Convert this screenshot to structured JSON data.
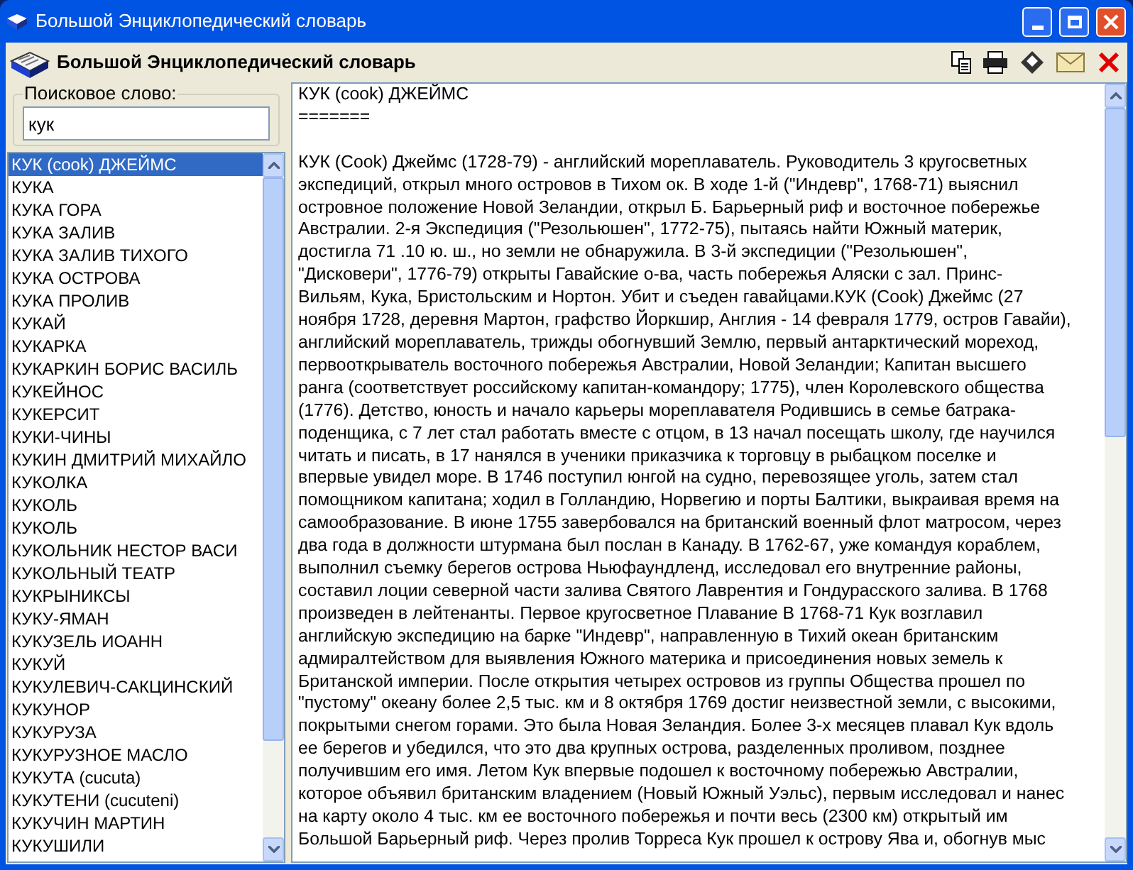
{
  "window": {
    "title": "Большой Энциклопедический словарь"
  },
  "header": {
    "title": "Большой Энциклопедический словарь"
  },
  "search": {
    "label": "Поисковое слово:",
    "value": "кук"
  },
  "entries": [
    {
      "label": "КУК (cook) ДЖЕЙМС",
      "selected": true
    },
    {
      "label": "КУКА",
      "selected": false
    },
    {
      "label": "КУКА ГОРА",
      "selected": false
    },
    {
      "label": "КУКА ЗАЛИВ",
      "selected": false
    },
    {
      "label": "КУКА ЗАЛИВ ТИХОГО",
      "selected": false
    },
    {
      "label": "КУКА ОСТРОВА",
      "selected": false
    },
    {
      "label": "КУКА ПРОЛИВ",
      "selected": false
    },
    {
      "label": "КУКАЙ",
      "selected": false
    },
    {
      "label": "КУКАРКА",
      "selected": false
    },
    {
      "label": "КУКАРКИН БОРИС ВАСИЛЬ",
      "selected": false
    },
    {
      "label": "КУКЕЙНОС",
      "selected": false
    },
    {
      "label": "КУКЕРСИТ",
      "selected": false
    },
    {
      "label": "КУКИ-ЧИНЫ",
      "selected": false
    },
    {
      "label": "КУКИН ДМИТРИЙ МИХАЙЛО",
      "selected": false
    },
    {
      "label": "КУКОЛКА",
      "selected": false
    },
    {
      "label": "КУКОЛЬ",
      "selected": false
    },
    {
      "label": "КУКОЛЬ",
      "selected": false
    },
    {
      "label": "КУКОЛЬНИК НЕСТОР ВАСИ",
      "selected": false
    },
    {
      "label": "КУКОЛЬНЫЙ ТЕАТР",
      "selected": false
    },
    {
      "label": "КУКРЫНИКСЫ",
      "selected": false
    },
    {
      "label": "КУКУ-ЯМАН",
      "selected": false
    },
    {
      "label": "КУКУЗЕЛЬ ИОАНН",
      "selected": false
    },
    {
      "label": "КУКУЙ",
      "selected": false
    },
    {
      "label": "КУКУЛЕВИЧ-САКЦИНСКИЙ",
      "selected": false
    },
    {
      "label": "КУКУНОР",
      "selected": false
    },
    {
      "label": "КУКУРУЗА",
      "selected": false
    },
    {
      "label": "КУКУРУЗНОЕ МАСЛО",
      "selected": false
    },
    {
      "label": "КУКУТА (cucuta)",
      "selected": false
    },
    {
      "label": "КУКУТЕНИ (cucuteni)",
      "selected": false
    },
    {
      "label": "КУКУЧИН МАРТИН",
      "selected": false
    },
    {
      "label": "КУКУШИЛИ",
      "selected": false
    }
  ],
  "article": {
    "heading": "КУК (cook) ДЖЕЙМС",
    "rule": "=======",
    "lines": [
      "КУК (Cook) Джеймс (1728-79) - английский мореплаватель. Руководитель 3 кругосветных",
      "экспедиций, открыл много островов в Тихом ок. В ходе 1-й (\"Индевр\", 1768-71) выяснил",
      "островное положение Новой Зеландии, открыл Б. Барьерный риф и восточное побережье",
      "Австралии. 2-я Экспедиция (\"Резольюшен\", 1772-75), пытаясь найти Южный материк,",
      "достигла 71 .10 ю. ш., но земли не обнаружила. В 3-й экспедиции (\"Резольюшен\",",
      "\"Дисковери\", 1776-79) открыты Гавайские о-ва, часть побережья Аляски с зал. Принс-",
      "Вильям, Кука, Бристольским и Нортон. Убит и съеден гавайцами.КУК (Cook) Джеймс (27",
      "ноября 1728, деревня Мартон, графство Йоркшир, Англия - 14 февраля 1779, остров Гавайи),",
      "английский мореплаватель, трижды обогнувший Землю, первый антарктический мореход,",
      "первооткрыватель восточного побережья Австралии, Новой Зеландии; Капитан высшего",
      "ранга (соответствует российскому капитан-командору; 1775), член Королевского общества",
      "(1776). Детство, юность и начало карьеры мореплавателя Родившись в семье батрака-",
      "поденщика, с 7 лет стал работать вместе с отцом, в 13 начал посещать школу, где научился",
      "читать и писать, в 17 нанялся в ученики приказчика к торговцу в рыбацком поселке и",
      "впервые увидел море. В 1746 поступил юнгой на судно, перевозящее уголь, затем стал",
      "помощником капитана; ходил в Голландию, Норвегию и порты Балтики, выкраивая время на",
      "самообразование. В июне 1755 завербовался на британский военный флот матросом, через",
      "два года в должности штурмана был послан в Канаду. В 1762-67, уже командуя кораблем,",
      "выполнил съемку берегов острова Ньюфаундленд, исследовал его внутренние районы,",
      "составил лоции северной части залива Святого Лаврентия и Гондурасского залива. В 1768",
      "произведен в лейтенанты. Первое кругосветное Плавание В 1768-71 Кук возглавил",
      "английскую экспедицию на барке \"Индевр\", направленную в Тихий океан британским",
      "адмиралтейством для выявления Южного материка и присоединения новых земель к",
      "Британской империи. После открытия четырех островов из группы Общества прошел по",
      "\"пустому\" океану более 2,5 тыс. км и 8 октября 1769 достиг неизвестной земли, с высокими,",
      "покрытыми снегом горами. Это была Новая Зеландия. Более 3-х месяцев плавал Кук вдоль",
      "ее берегов и убедился, что это два крупных острова, разделенных проливом, позднее",
      "получившим его имя. Летом Кук впервые подошел к восточному побережью Австралии,",
      "которое объявил британским владением (Новый Южный Уэльс), первым исследовал и нанес",
      "на карту около 4 тыс. км ее восточного побережья и почти весь (2300 км) открытый им",
      "Большой Барьерный риф. Через пролив Торреса Кук прошел к острову Ява и, обогнув мыс"
    ]
  }
}
